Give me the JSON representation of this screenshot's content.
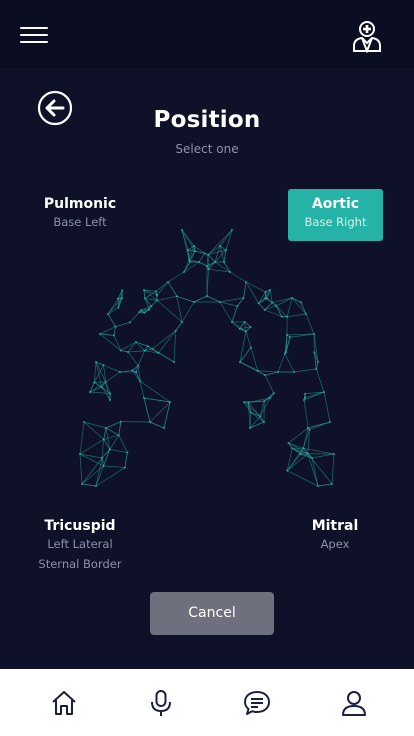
{
  "header": {
    "menu_icon": "hamburger-menu-icon",
    "profile_icon": "doctor-icon"
  },
  "page": {
    "back_icon": "back-arrow-icon",
    "title": "Position",
    "subtitle": "Select one"
  },
  "positions": [
    {
      "id": "pulmonic",
      "name": "Pulmonic",
      "desc": "Base Left",
      "selected": false
    },
    {
      "id": "aortic",
      "name": "Aortic",
      "desc": "Base Right",
      "selected": true
    },
    {
      "id": "tricuspid",
      "name": "Tricuspid",
      "desc_line1": "Left Lateral",
      "desc_line2": "Sternal Border",
      "selected": false
    },
    {
      "id": "mitral",
      "name": "Mitral",
      "desc": "Apex",
      "selected": false
    }
  ],
  "cancel_label": "Cancel",
  "bottom_nav": [
    {
      "icon": "home-icon"
    },
    {
      "icon": "microphone-icon"
    },
    {
      "icon": "chat-icon"
    },
    {
      "icon": "user-icon"
    }
  ],
  "colors": {
    "background": "#0e1128",
    "accent": "#24b3a6",
    "torso_mesh": "#1f8f8a",
    "cancel": "#6e707e"
  }
}
